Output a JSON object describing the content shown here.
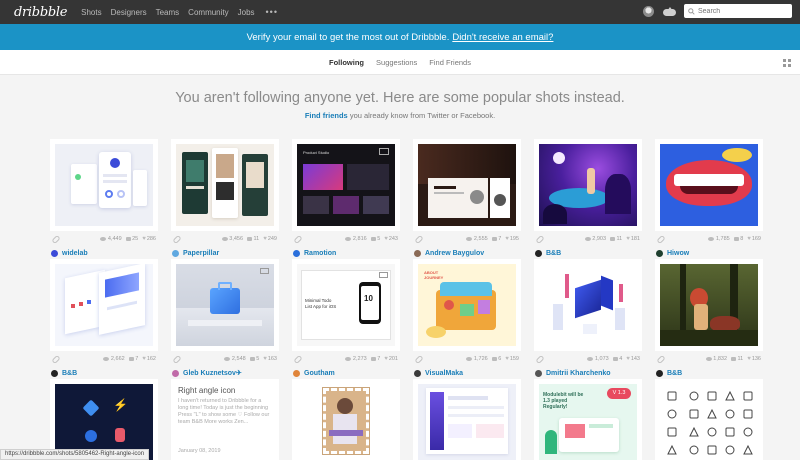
{
  "topnav": {
    "logo": "dribbble",
    "links": [
      "Shots",
      "Designers",
      "Teams",
      "Community",
      "Jobs"
    ],
    "more": "•••",
    "search_placeholder": "Search"
  },
  "banner": {
    "text": "Verify your email to get the most out of Dribbble.",
    "link": "Didn't receive an email?"
  },
  "subnav": {
    "tabs": [
      "Following",
      "Suggestions",
      "Find Friends"
    ],
    "active": "Following"
  },
  "main": {
    "heading": "You aren't following anyone yet. Here are some popular shots instead.",
    "find_link": "Find friends",
    "find_rest": "you already know from Twitter or Facebook."
  },
  "shots": [
    {
      "views": "4,449",
      "comments": "25",
      "likes": "286",
      "author": "widelab",
      "avatar_color": "#3b4bd8"
    },
    {
      "views": "3,456",
      "comments": "11",
      "likes": "249",
      "author": "Paperpillar",
      "avatar_color": "#5fa8e0"
    },
    {
      "views": "2,816",
      "comments": "5",
      "likes": "243",
      "author": "Ramotion",
      "avatar_color": "#2a6fdb"
    },
    {
      "views": "2,555",
      "comments": "7",
      "likes": "195",
      "author": "Andrew Baygulov",
      "avatar_color": "#8a6a55"
    },
    {
      "views": "2,903",
      "comments": "11",
      "likes": "181",
      "author": "B&B",
      "avatar_color": "#222222"
    },
    {
      "views": "1,785",
      "comments": "8",
      "likes": "169",
      "author": "Hiwow",
      "avatar_color": "#1f3f2f"
    },
    {
      "views": "2,662",
      "comments": "7",
      "likes": "162",
      "author": "B&B",
      "avatar_color": "#222222"
    },
    {
      "views": "2,548",
      "comments": "5",
      "likes": "163",
      "author": "Gleb Kuznetsov✈",
      "avatar_color": "#c06aa8"
    },
    {
      "views": "2,273",
      "comments": "7",
      "likes": "201",
      "author": "Goutham",
      "avatar_color": "#e0853a"
    },
    {
      "views": "1,726",
      "comments": "6",
      "likes": "159",
      "author": "VisualMaka",
      "avatar_color": "#3a3a3a"
    },
    {
      "views": "1,073",
      "comments": "4",
      "likes": "143",
      "author": "Dmitrii Kharchenko",
      "avatar_color": "#555555"
    },
    {
      "views": "1,832",
      "comments": "11",
      "likes": "136",
      "author": "B&B",
      "avatar_color": "#222222"
    }
  ],
  "text_shot": {
    "title": "Right angle icon",
    "body": "I haven't returned to Dribbble for a long time! Today is just the beginning Press \"L\" to show some ♡ Follow our team B&B More works Zen...",
    "date": "January 08, 2019"
  },
  "promo_card": {
    "badge": "V 1.3",
    "line1": "Modulebit will be",
    "line2": "1.3 played",
    "line3": "Regularly!"
  },
  "thumb_texts": {
    "ramotion_header": "Product Studio",
    "goutham_a": "Minimal Todo",
    "goutham_b": "List App for iOS",
    "goutham_num": "10",
    "visualmaka_a": "ABOUT",
    "visualmaka_b": "JOURNEY"
  },
  "status_url": "https://dribbble.com/shots/5805462-Right-angle-icon"
}
